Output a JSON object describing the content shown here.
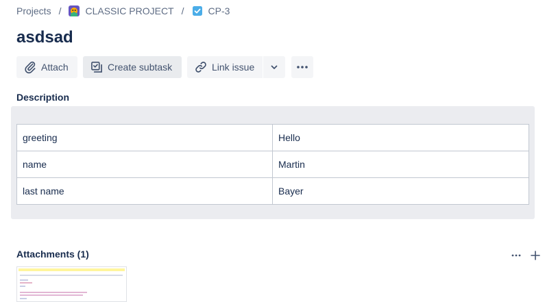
{
  "breadcrumb": {
    "projects": "Projects",
    "separator": "/",
    "project": "CLASSIC PROJECT",
    "issue_key": "CP-3"
  },
  "issue": {
    "title": "asdsad"
  },
  "toolbar": {
    "attach": "Attach",
    "create_subtask": "Create subtask",
    "link_issue": "Link issue"
  },
  "description": {
    "label": "Description",
    "rows": [
      {
        "key": "greeting",
        "value": "Hello"
      },
      {
        "key": "name",
        "value": "Martin"
      },
      {
        "key": "last name",
        "value": "Bayer"
      }
    ]
  },
  "attachments": {
    "label": "Attachments (1)"
  },
  "colors": {
    "text_primary": "#172b4d",
    "text_subtle": "#5e6c84",
    "button_bg": "#f4f5f7",
    "panel_bg": "#ebecf0",
    "checkbox_blue": "#4bade8"
  },
  "icons": {
    "project": "project-avatar-icon",
    "issue_type": "task-checkbox-icon",
    "attach": "paperclip-icon",
    "subtask": "subtask-icon",
    "link": "link-icon",
    "caret": "chevron-down-icon",
    "more": "more-horizontal-icon",
    "add": "plus-icon"
  }
}
